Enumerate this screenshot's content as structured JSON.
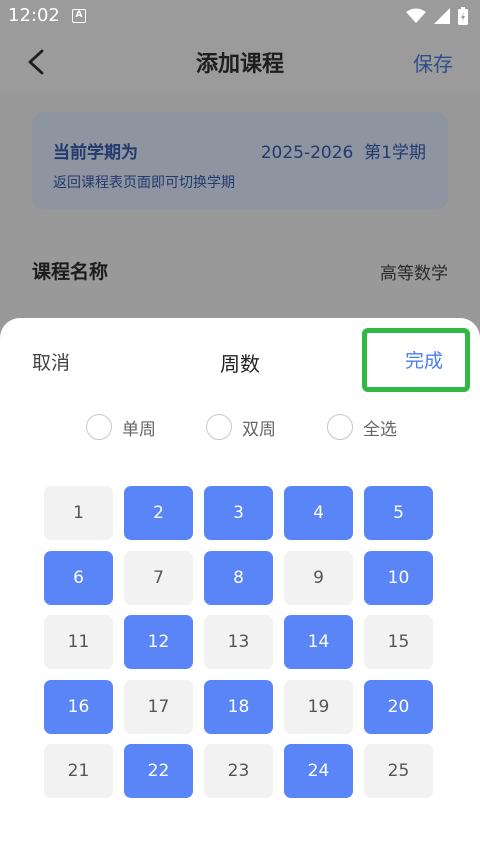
{
  "status": {
    "time": "12:02",
    "notif_letter": "A"
  },
  "header": {
    "title": "添加课程",
    "save_label": "保存"
  },
  "term": {
    "label": "当前学期为",
    "value": "2025-2026  第1学期",
    "hint": "返回课程表页面即可切换学期"
  },
  "course": {
    "label": "课程名称",
    "value": "高等数学"
  },
  "sheet": {
    "cancel_label": "取消",
    "title": "周数",
    "done_label": "完成",
    "options": [
      "单周",
      "双周",
      "全选"
    ],
    "weeks": [
      {
        "n": "1",
        "selected": false
      },
      {
        "n": "2",
        "selected": true
      },
      {
        "n": "3",
        "selected": true
      },
      {
        "n": "4",
        "selected": true
      },
      {
        "n": "5",
        "selected": true
      },
      {
        "n": "6",
        "selected": true
      },
      {
        "n": "7",
        "selected": false
      },
      {
        "n": "8",
        "selected": true
      },
      {
        "n": "9",
        "selected": false
      },
      {
        "n": "10",
        "selected": true
      },
      {
        "n": "11",
        "selected": false
      },
      {
        "n": "12",
        "selected": true
      },
      {
        "n": "13",
        "selected": false
      },
      {
        "n": "14",
        "selected": true
      },
      {
        "n": "15",
        "selected": false
      },
      {
        "n": "16",
        "selected": true
      },
      {
        "n": "17",
        "selected": false
      },
      {
        "n": "18",
        "selected": true
      },
      {
        "n": "19",
        "selected": false
      },
      {
        "n": "20",
        "selected": true
      },
      {
        "n": "21",
        "selected": false
      },
      {
        "n": "22",
        "selected": true
      },
      {
        "n": "23",
        "selected": false
      },
      {
        "n": "24",
        "selected": true
      },
      {
        "n": "25",
        "selected": false
      }
    ]
  },
  "colors": {
    "selected": "#5a85f7",
    "unselected": "#f2f2f2",
    "done_highlight": "#2fb943"
  }
}
